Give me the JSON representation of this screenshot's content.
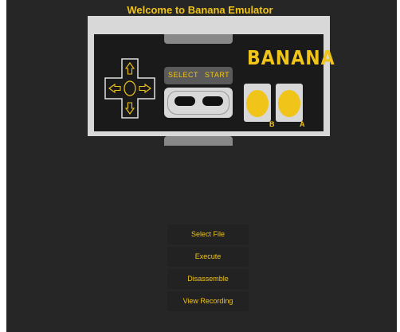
{
  "header": {
    "title": "Welcome to Banana Emulator"
  },
  "controller": {
    "brand": "BANANA",
    "select_label": "SELECT",
    "start_label": "START",
    "button_b_label": "B",
    "button_a_label": "A"
  },
  "menu": {
    "items": [
      {
        "label": "Select File"
      },
      {
        "label": "Execute"
      },
      {
        "label": "Disassemble"
      },
      {
        "label": "View Recording"
      }
    ]
  },
  "colors": {
    "accent": "#f0c419",
    "background": "#262626",
    "controller_body": "#1a1a1a",
    "controller_frame": "#d8d8d8"
  }
}
